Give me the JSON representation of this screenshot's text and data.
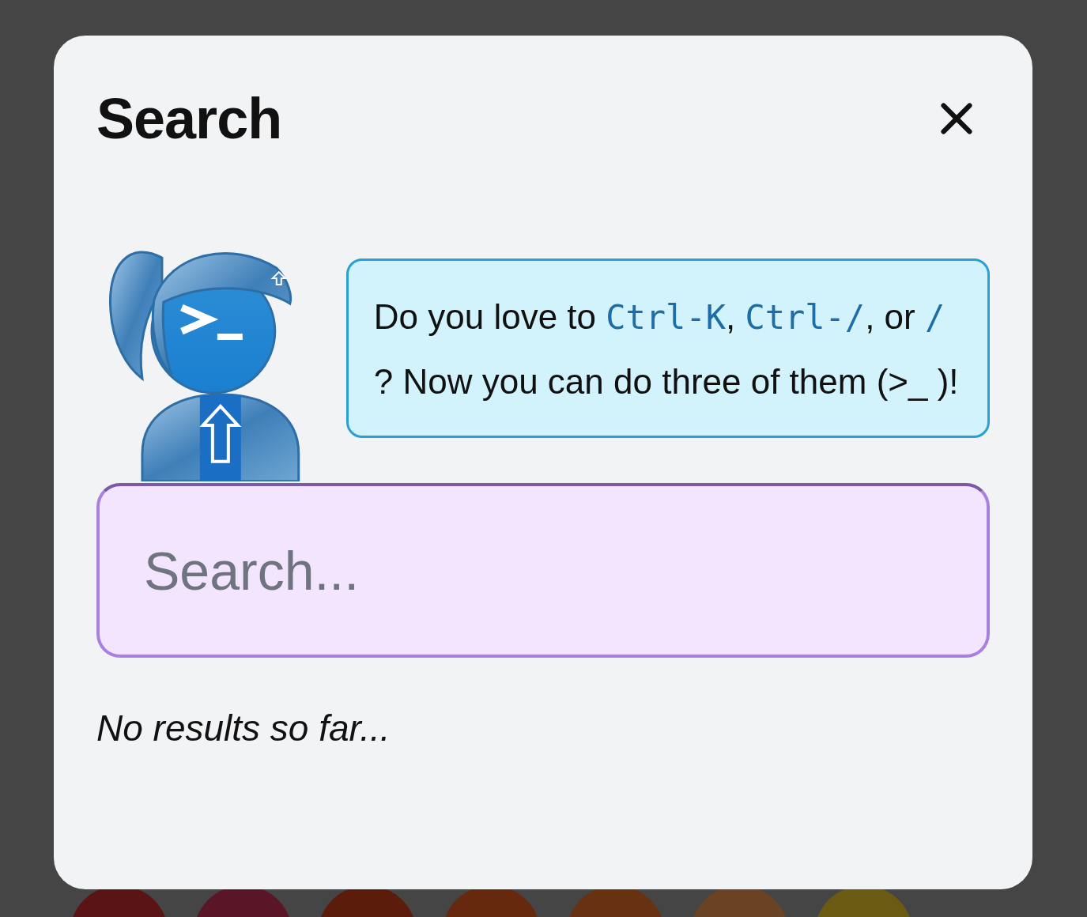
{
  "dialog": {
    "title": "Search"
  },
  "message": [
    {
      "kind": "text",
      "text": "Do you love to "
    },
    {
      "kind": "code",
      "text": "Ctrl-K"
    },
    {
      "kind": "text",
      "text": ", "
    },
    {
      "kind": "code",
      "text": "Ctrl-/"
    },
    {
      "kind": "text",
      "text": ", or "
    },
    {
      "kind": "code",
      "text": "/"
    },
    {
      "kind": "text",
      "text": " ? Now you can do three of them (>_ )!"
    }
  ],
  "search": {
    "placeholder": "Search..."
  },
  "results": {
    "empty_text": "No results so far..."
  },
  "background_icons": [
    {
      "color": "#5a1416"
    },
    {
      "color": "#5a1626"
    },
    {
      "color": "#5c1c0c"
    },
    {
      "color": "#66290e"
    },
    {
      "color": "#683212"
    },
    {
      "color": "#6a4224"
    },
    {
      "color": "#6a5a12"
    }
  ]
}
